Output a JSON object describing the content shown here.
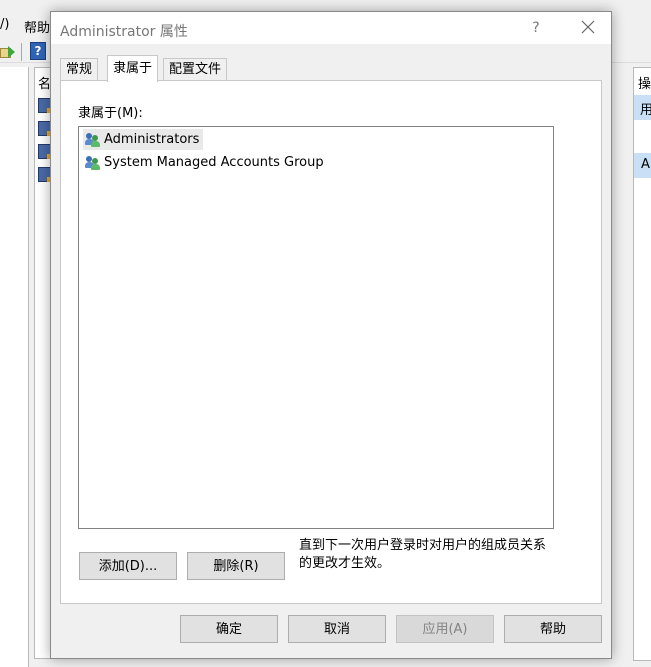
{
  "background": {
    "menu": {
      "item1": "/)",
      "item2": "帮助"
    },
    "mid_header": "名",
    "right_header": "操",
    "right_item1": "用",
    "right_item2": "A"
  },
  "dialog": {
    "title": "Administrator 属性",
    "help_glyph": "?",
    "tabs": [
      {
        "label": "常规"
      },
      {
        "label": "隶属于"
      },
      {
        "label": "配置文件"
      }
    ],
    "memberof_label": "隶属于(M):",
    "groups": [
      {
        "name": "Administrators"
      },
      {
        "name": "System Managed Accounts Group"
      }
    ],
    "add_label": "添加(D)...",
    "remove_label": "删除(R)",
    "note_line1": "直到下一次用户登录时对用户的组成员关系",
    "note_line2": "的更改才生效。",
    "ok_label": "确定",
    "cancel_label": "取消",
    "apply_label": "应用(A)",
    "help_label": "帮助"
  }
}
